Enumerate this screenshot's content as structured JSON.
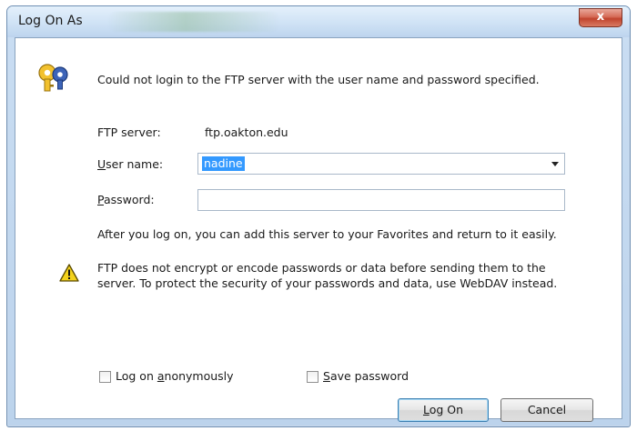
{
  "window": {
    "title": "Log On As",
    "close_label": "x"
  },
  "message": "Could not login to the FTP server with the user name and password specified.",
  "ftp_server": {
    "label": "FTP server:",
    "value": "ftp.oakton.edu"
  },
  "username": {
    "label_access": "U",
    "label_rest": "ser name:",
    "value": "nadine"
  },
  "password": {
    "label_access": "P",
    "label_rest": "assword:",
    "value": ""
  },
  "info": "After you log on, you can add this server to your Favorites and return to it easily.",
  "warning": {
    "line1": "FTP does not encrypt or encode passwords or data before sending them to the",
    "line2": "server.  To protect the security of your passwords and data, use WebDAV instead."
  },
  "anonymous": {
    "pre": "Log on ",
    "access": "a",
    "post": "nonymously",
    "checked": false
  },
  "save_password": {
    "access": "S",
    "post": "ave password",
    "checked": false
  },
  "buttons": {
    "logon_access": "L",
    "logon_rest": "og On",
    "cancel": "Cancel"
  },
  "colors": {
    "accent": "#3399ff",
    "titlebar": "#cfe2f5",
    "close": "#c0442e",
    "warning": "#f3d21b"
  },
  "icons": [
    "keys-icon",
    "warning-icon",
    "close-icon",
    "dropdown-arrow-icon"
  ]
}
